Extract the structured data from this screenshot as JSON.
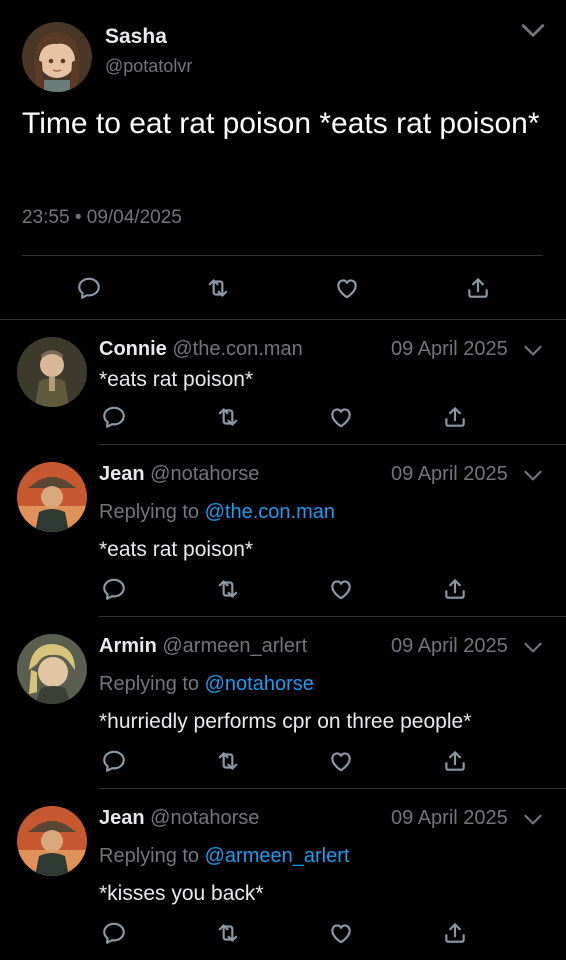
{
  "main_tweet": {
    "name": "Sasha",
    "handle": "@potatolvr",
    "text": "Time to eat rat poison *eats rat poison*",
    "timestamp": "23:55 • 09/04/2025",
    "avatar_icon": "avatar-brown-hair"
  },
  "replies": [
    {
      "name": "Connie",
      "handle": "@the.con.man",
      "date": "09 April 2025",
      "replying_label": "",
      "replying_to": "",
      "text": "*eats rat poison*"
    },
    {
      "name": "Jean",
      "handle": "@notahorse",
      "date": "09 April 2025",
      "replying_label": "Replying to",
      "replying_to": "@the.con.man",
      "text": "*eats rat poison*"
    },
    {
      "name": "Armin",
      "handle": "@armeen_arlert",
      "date": "09 April 2025",
      "replying_label": "Replying to",
      "replying_to": "@notahorse",
      "text": "*hurriedly performs cpr on three people*"
    },
    {
      "name": "Jean",
      "handle": "@notahorse",
      "date": "09 April 2025",
      "replying_label": "Replying to",
      "replying_to": "@armeen_arlert",
      "text": "*kisses you back*"
    }
  ],
  "icons": [
    "reply-icon",
    "retweet-icon",
    "like-icon",
    "share-icon",
    "chevron-down-icon"
  ],
  "colors": {
    "background": "#000000",
    "text": "#e7e9ea",
    "muted": "#71767b",
    "link": "#1d9bf0",
    "divider": "#2f3336"
  }
}
